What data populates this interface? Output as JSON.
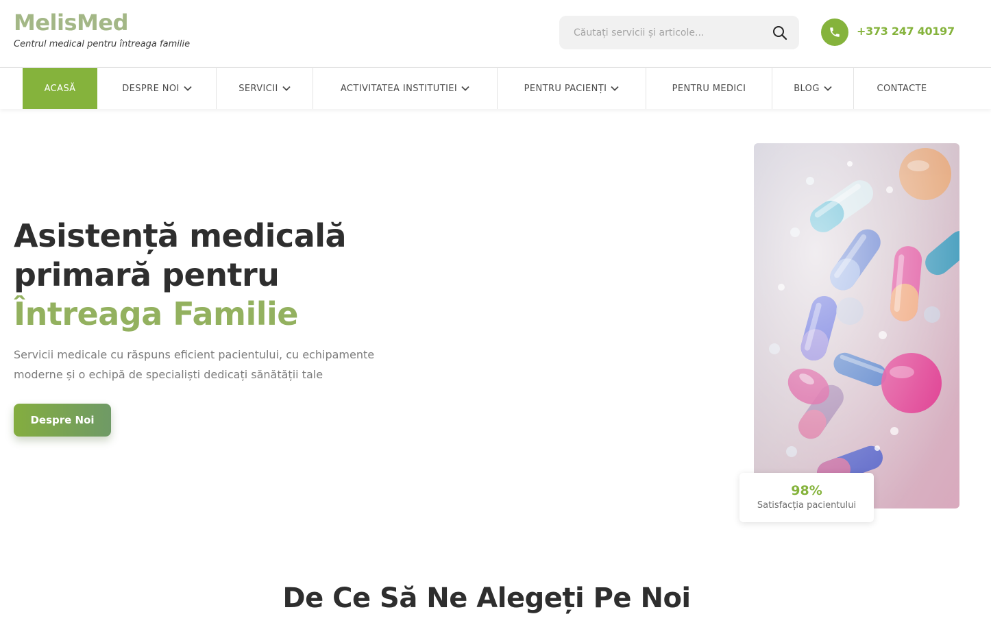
{
  "brand": {
    "name": "MelisMed",
    "tagline": "Centrul medical pentru întreaga familie"
  },
  "search": {
    "placeholder": "Căutați servicii și articole...",
    "value": "",
    "icon": "search-icon"
  },
  "contact": {
    "phone": "+373 247 40197",
    "icon": "phone-icon"
  },
  "nav": {
    "items": [
      {
        "label": "ACASĂ",
        "active": true,
        "dropdown": false
      },
      {
        "label": "DESPRE NOI",
        "active": false,
        "dropdown": true
      },
      {
        "label": "SERVICII",
        "active": false,
        "dropdown": true
      },
      {
        "label": "ACTIVITATEA INSTITUTIEI",
        "active": false,
        "dropdown": true
      },
      {
        "label": "PENTRU PACIENȚI",
        "active": false,
        "dropdown": true
      },
      {
        "label": "PENTRU MEDICI",
        "active": false,
        "dropdown": false
      },
      {
        "label": "BLOG",
        "active": false,
        "dropdown": true
      },
      {
        "label": "CONTACTE",
        "active": false,
        "dropdown": false
      }
    ]
  },
  "hero": {
    "title_line1": "Asistență medicală",
    "title_line2": "primară pentru",
    "title_accent": "Întreaga Familie",
    "description": "Servicii medicale cu răspuns eficient pacientului, cu echipamente moderne și o echipă de specialiști dedicați sănătății tale",
    "button_label": "Despre Noi",
    "stat": {
      "value": "98%",
      "label": "Satisfacția pacientului"
    }
  },
  "section": {
    "title": "De Ce Să Ne Alegeți Pe Noi"
  },
  "colors": {
    "brand_green": "#85b33c",
    "logo_green": "#a3b786",
    "accent_title": "#93b15f",
    "text_dark": "#2e2e2e"
  }
}
